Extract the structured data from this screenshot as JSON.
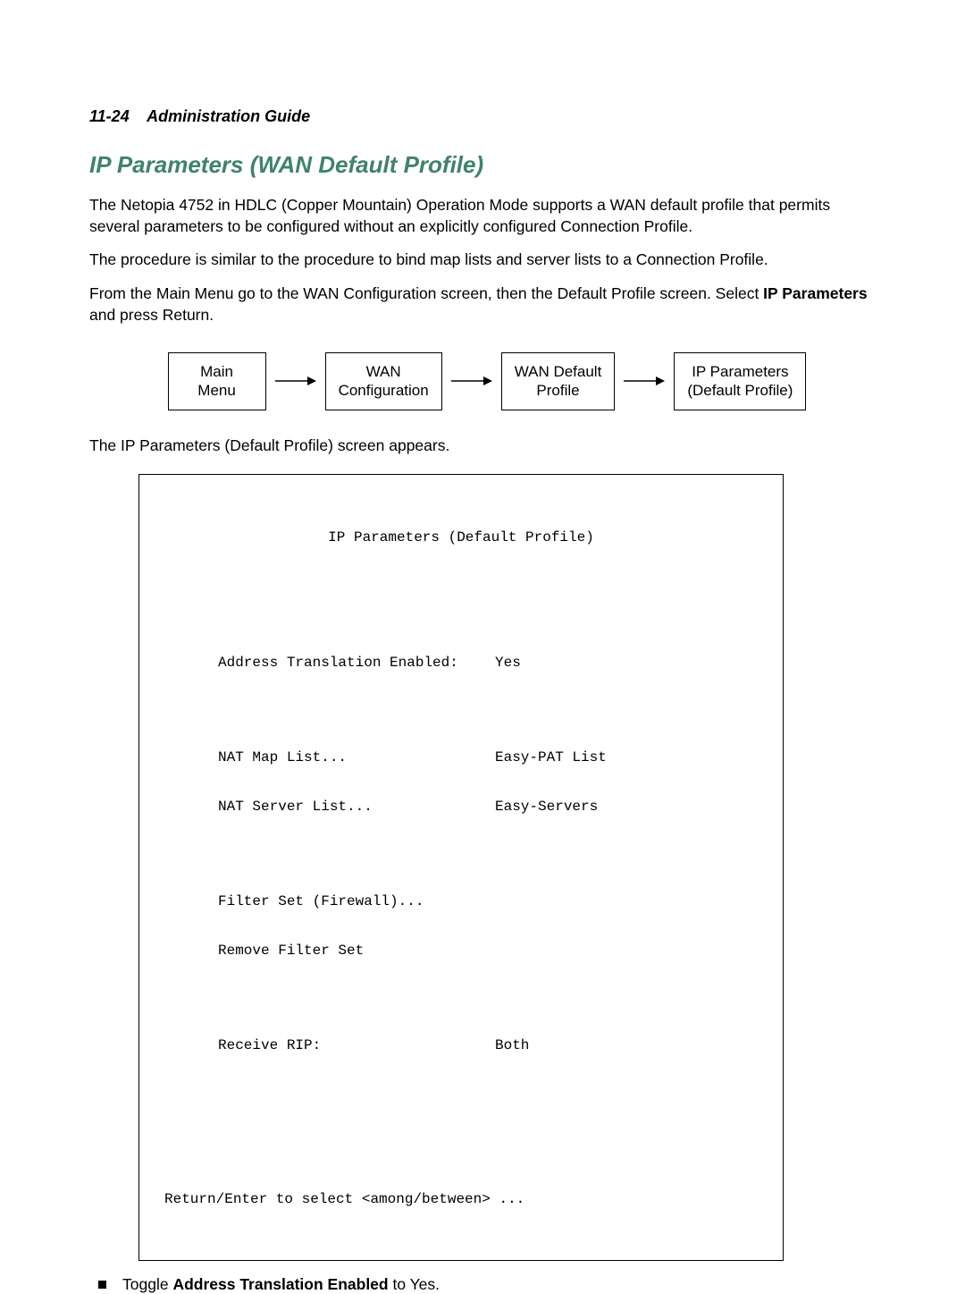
{
  "header": {
    "page_number": "11-24",
    "doc_title": "Administration Guide"
  },
  "section": {
    "title": "IP Parameters (WAN Default Profile)"
  },
  "paragraphs": {
    "p1": "The Netopia 4752 in HDLC (Copper Mountain) Operation Mode supports a WAN default profile that permits several parameters to be configured without an explicitly configured Connection Profile.",
    "p2": "The procedure is similar to the procedure to bind map lists and server lists to a Connection Profile.",
    "p3_pre": "From the Main Menu go to the WAN Configuration screen, then the Default Profile screen. Select ",
    "p3_bold": "IP Parameters",
    "p3_post": " and press Return.",
    "p4": "The IP Parameters (Default Profile) screen appears."
  },
  "flow": {
    "box1": "Main\nMenu",
    "box2": "WAN\nConfiguration",
    "box3": "WAN Default\nProfile",
    "box4": "IP Parameters\n(Default Profile)"
  },
  "terminal": {
    "title": "IP Parameters (Default Profile)",
    "rows": [
      {
        "label": "Address Translation Enabled:",
        "value": "Yes"
      }
    ],
    "rows2": [
      {
        "label": "NAT Map List...",
        "value": "Easy-PAT List"
      },
      {
        "label": "NAT Server List...",
        "value": "Easy-Servers"
      }
    ],
    "rows3": [
      {
        "label": "Filter Set (Firewall)...",
        "value": ""
      },
      {
        "label": "Remove Filter Set",
        "value": ""
      }
    ],
    "rows4": [
      {
        "label": "Receive RIP:",
        "value": "Both"
      }
    ],
    "bottom": "Return/Enter to select <among/between> ..."
  },
  "bullets": {
    "b1_pre": "Toggle ",
    "b1_bold": "Address Translation Enabled",
    "b1_post": " to Yes."
  }
}
